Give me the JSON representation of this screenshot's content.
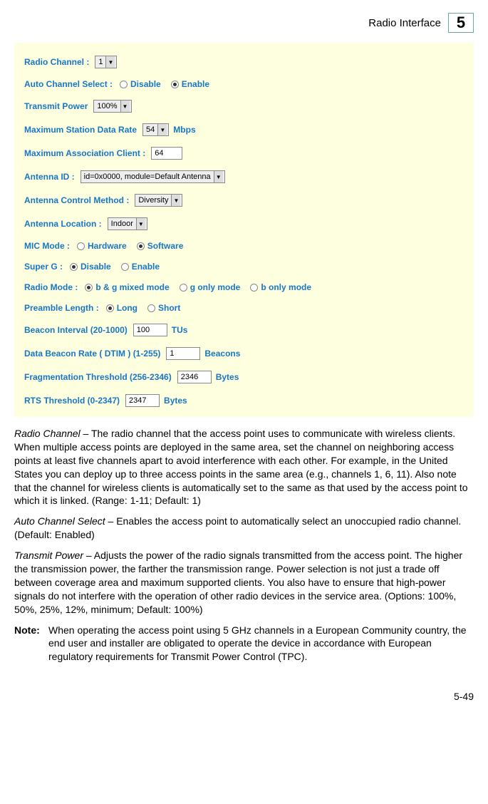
{
  "header": {
    "section": "Radio Interface",
    "chapter": "5"
  },
  "panel": {
    "radio_channel": {
      "label": "Radio Channel :",
      "value": "1"
    },
    "auto_channel": {
      "label": "Auto Channel Select :",
      "opt1": "Disable",
      "opt2": "Enable"
    },
    "transmit_power": {
      "label": "Transmit Power",
      "value": "100%"
    },
    "max_data_rate": {
      "label": "Maximum Station Data Rate",
      "value": "54",
      "suffix": "Mbps"
    },
    "max_assoc": {
      "label": "Maximum Association Client :",
      "value": "64"
    },
    "antenna_id": {
      "label": "Antenna ID :",
      "value": "id=0x0000, module=Default Antenna"
    },
    "antenna_ctrl": {
      "label": "Antenna Control Method :",
      "value": "Diversity"
    },
    "antenna_loc": {
      "label": "Antenna Location :",
      "value": "Indoor"
    },
    "mic_mode": {
      "label": "MIC Mode :",
      "opt1": "Hardware",
      "opt2": "Software"
    },
    "super_g": {
      "label": "Super G :",
      "opt1": "Disable",
      "opt2": "Enable"
    },
    "radio_mode": {
      "label": "Radio Mode :",
      "opt1": "b & g mixed mode",
      "opt2": "g only mode",
      "opt3": "b only mode"
    },
    "preamble": {
      "label": "Preamble Length :",
      "opt1": "Long",
      "opt2": "Short"
    },
    "beacon_int": {
      "label": "Beacon Interval (20-1000)",
      "value": "100",
      "suffix": "TUs"
    },
    "dtim": {
      "label": "Data Beacon Rate ( DTIM ) (1-255)",
      "value": "1",
      "suffix": "Beacons"
    },
    "frag": {
      "label": "Fragmentation Threshold (256-2346)",
      "value": "2346",
      "suffix": "Bytes"
    },
    "rts": {
      "label": "RTS Threshold (0-2347)",
      "value": "2347",
      "suffix": "Bytes"
    }
  },
  "body": {
    "p1_term": "Radio Channel",
    "p1": " – The radio channel that the access point uses to communicate with wireless clients. When multiple access points are deployed in the same area, set the channel on neighboring access points at least five channels apart to avoid interference with each other. For example, in the United States you can deploy up to three access points in the same area (e.g., channels 1, 6, 11). Also note that the channel for wireless clients is automatically set to the same as that used by the access point to which it is linked. (Range: 1-11; Default: 1)",
    "p2_term": "Auto Channel Select",
    "p2": " – Enables the access point to automatically select an unoccupied radio channel. (Default: Enabled)",
    "p3_term": "Transmit Power",
    "p3": " – Adjusts the power of the radio signals transmitted from the access point. The higher the transmission power, the farther the transmission range. Power selection is not just a trade off between coverage area and maximum supported clients. You also have to ensure that high-power signals do not interfere with the operation of other radio devices in the service area. (Options: 100%, 50%, 25%, 12%, minimum; Default: 100%)",
    "note_label": "Note:",
    "note": "When operating the access point using 5 GHz channels in a European Community country, the end user and installer are obligated to operate the device in accordance with European regulatory requirements for Transmit Power Control (TPC)."
  },
  "footer": {
    "page": "5-49"
  }
}
